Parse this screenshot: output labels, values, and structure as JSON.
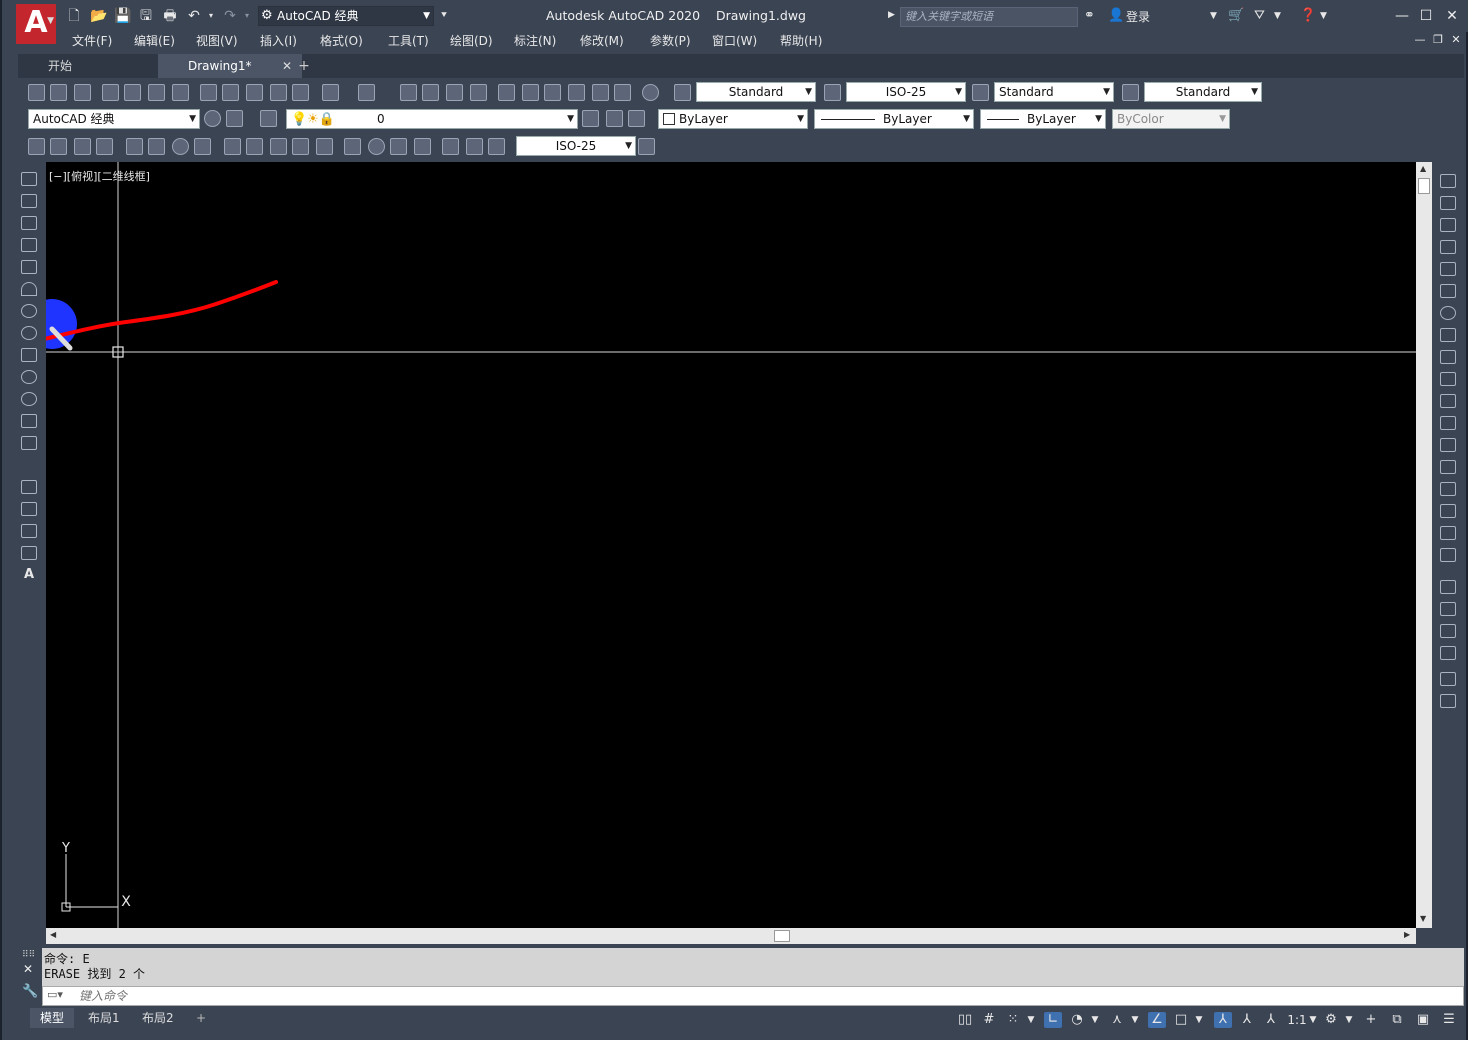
{
  "window": {
    "app_title": "Autodesk AutoCAD 2020",
    "document_title": "Drawing1.dwg",
    "logo_letter": "A",
    "workspace": "AutoCAD 经典",
    "search_placeholder": "键入关键字或短语",
    "login_label": "登录"
  },
  "menu": [
    "文件(F)",
    "编辑(E)",
    "视图(V)",
    "插入(I)",
    "格式(O)",
    "工具(T)",
    "绘图(D)",
    "标注(N)",
    "修改(M)",
    "参数(P)",
    "窗口(W)",
    "帮助(H)"
  ],
  "tabs": {
    "start": "开始",
    "drawing": "Drawing1*",
    "add": "+"
  },
  "styles_toolbar": {
    "text_style": "Standard",
    "dim_style": "ISO-25",
    "table_style": "Standard",
    "mleader_style": "Standard"
  },
  "layers_toolbar": {
    "workspace": "AutoCAD 经典",
    "layer": "0",
    "color": "ByLayer",
    "linetype": "ByLayer",
    "lineweight": "ByLayer",
    "plot_style": "ByColor"
  },
  "dim_toolbar": {
    "dim_style": "ISO-25"
  },
  "viewport": {
    "label": "[−][俯视][二维线框]",
    "ucs_x": "X",
    "ucs_y": "Y"
  },
  "command": {
    "history": [
      "命令: E",
      "ERASE 找到 2 个"
    ],
    "input_placeholder": "键入命令"
  },
  "layout_tabs": [
    "模型",
    "布局1",
    "布局2"
  ],
  "status": {
    "scale": "1:1"
  },
  "colors": {
    "canvas": "#000000",
    "chrome": "#3b4453",
    "annotation_stroke": "#ff0000",
    "cursor_highlight": "#1f35ff"
  }
}
